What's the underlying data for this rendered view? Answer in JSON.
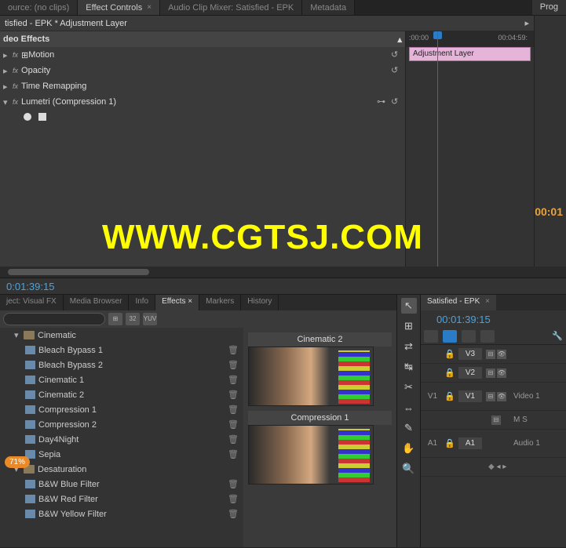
{
  "topTabs": {
    "source": "ource: (no clips)",
    "effectControls": "Effect Controls",
    "audioMixer": "Audio Clip Mixer: Satisfied - EPK",
    "metadata": "Metadata",
    "program": "Prog"
  },
  "ec": {
    "clipPath": "tisfied - EPK * Adjustment Layer",
    "section": "deo Effects",
    "motion": "Motion",
    "opacity": "Opacity",
    "timeRemap": "Time Remapping",
    "lumetri": "Lumetri (Compression 1)"
  },
  "miniTL": {
    "start": ":00:00",
    "end": "00:04:59:",
    "clip": "Adjustment Layer"
  },
  "programTC": "00:01",
  "watermark": "WWW.CGTSJ.COM",
  "midTC": "0:01:39:15",
  "lpTabs": {
    "project": "ject: Visual FX",
    "mediaBrowser": "Media Browser",
    "info": "Info",
    "effects": "Effects",
    "markers": "Markers",
    "history": "History"
  },
  "toolbarBtns": {
    "b1": "⊞",
    "b2": "32",
    "b3": "YUV"
  },
  "tree": {
    "cinematic": "Cinematic",
    "items": [
      "Bleach Bypass 1",
      "Bleach Bypass 2",
      "Cinematic 1",
      "Cinematic 2",
      "Compression 1",
      "Compression 2",
      "Day4Night",
      "Sepia"
    ],
    "desaturation": "Desaturation",
    "desatItems": [
      "B&W Blue Filter",
      "B&W Red Filter",
      "B&W Yellow Filter"
    ]
  },
  "preview": {
    "t1": "Cinematic 2",
    "t2": "Compression 1"
  },
  "badge": "71%",
  "tools": [
    "↖",
    "⊞",
    "⇄",
    "↹",
    "✂",
    "⇔",
    "✎",
    "✋",
    "🔍"
  ],
  "timeline": {
    "tab": "Satisfied - EPK",
    "tc": "00:01:39:15",
    "v3": "V3",
    "v2": "V2",
    "v1src": "V1",
    "v1": "V1",
    "video1": "Video 1",
    "ms": "M  S",
    "a1src": "A1",
    "a1": "A1",
    "audio1": "Audio 1"
  }
}
